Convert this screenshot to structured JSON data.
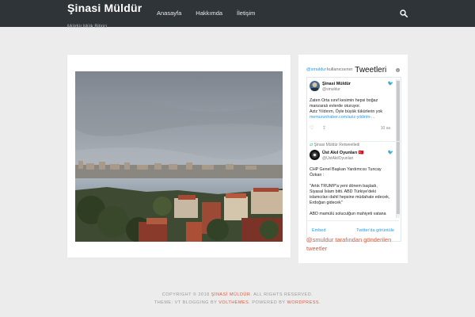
{
  "header": {
    "brand": "Şinasi Müldür",
    "tagline": "Müldür Mülk Bitirici",
    "nav": [
      "Anasayfa",
      "Hakkımda",
      "İletişim"
    ]
  },
  "sidebar": {
    "widget_user": "@smuldur",
    "widget_user_rest": "kullanıcısının",
    "widget_title": "Tweetleri",
    "tweets": [
      {
        "name": "Şinasi Müldür",
        "handle": "@smuldur",
        "text": "Zaten Orta sınıf kesimin hepsi boğaz manzaralı evlerde oturuyor.",
        "text2": "Aziz Yıldırım, Öyle büyük tükürlerin yok",
        "link": "memurunhaber.com/aziz-yildirim-...",
        "time": "10 sa"
      },
      {
        "retweeted": "Şinasi Müldür Retweetledi",
        "name": "Üst Akıl Oyunları 🇹🇷",
        "handle": "@UstAkilOyunlari",
        "text": "CHP Genel Başkan Yardımcısı Tuncay Özkan :",
        "text2": "\"Artık TRUMP'a yeni dönem başladı, Siyasal İslam bitti. ABD Türkiye'deki islamcıları dahil hepsine müdahale edecek, Erdoğan gidecek\"",
        "text3": "ABD mamülü soluculğun mahiyeti vatana"
      }
    ],
    "embed_link": "Embed",
    "view_link": "Twitter'da görüntüle",
    "footer_link": "@smuldur tarafından gönderilen tweetler"
  },
  "footer": {
    "line1_pre": "COPYRIGHT © 2018 ",
    "line1_name": "ŞİNASİ MÜLDÜR",
    "line1_post": ". ALL RIGHTS RESERVED.",
    "line2_pre": "THEME: VT BLOGGING BY ",
    "line2_theme": "VOLTHEMES",
    "line2_mid": ". POWERED BY ",
    "line2_wp": "WORDPRESS",
    "line2_post": "."
  },
  "colors": {
    "header_bg": "#2f3439",
    "accent": "#e05a3a",
    "twitter_blue": "#1d9bf0",
    "page_bg": "#ececec"
  },
  "icons": {
    "search": "search-icon",
    "twitter": "bird-icon",
    "info": "info-icon"
  }
}
